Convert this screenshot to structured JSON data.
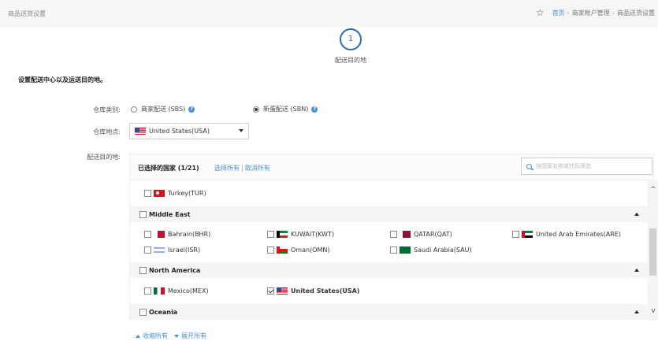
{
  "header": {
    "page_title": "商品送货设置",
    "breadcrumb": [
      "首页",
      "商家帐户管理",
      "商品送货设置"
    ]
  },
  "step": {
    "number": "1",
    "label": "配送目的地"
  },
  "section_heading": "设置配送中心以及运送目的地。",
  "form": {
    "warehouse_type_label": "仓库类别:",
    "warehouse_type_options": [
      {
        "label": "商家配送 (SBS)",
        "selected": false
      },
      {
        "label": "新蛋配送 (SBN)",
        "selected": true
      }
    ],
    "warehouse_location_label": "仓库地点:",
    "warehouse_location_value": "United States(USA)",
    "destination_label": "配送目的地:"
  },
  "destinations": {
    "selected_count_label": "已选择的国家 (1/21)",
    "select_all": "选择所有",
    "deselect_all": "取消所有",
    "search_placeholder": "按国家名称或代码筛选",
    "top_item": "Turkey(TUR)",
    "regions": [
      {
        "name": "Middle East",
        "countries": [
          "Bahrain(BHR)",
          "KUWAIT(KWT)",
          "QATAR(QAT)",
          "United Arab Emirates(ARE)",
          "Israel(ISR)",
          "Oman(OMN)",
          "Saudi Arabia(SAU)"
        ]
      },
      {
        "name": "North America",
        "countries": [
          "Mexico(MEX)",
          "United States(USA)"
        ]
      },
      {
        "name": "Oceania",
        "countries": []
      }
    ],
    "collapse_all": "收缩所有",
    "expand_all": "展开所有"
  }
}
